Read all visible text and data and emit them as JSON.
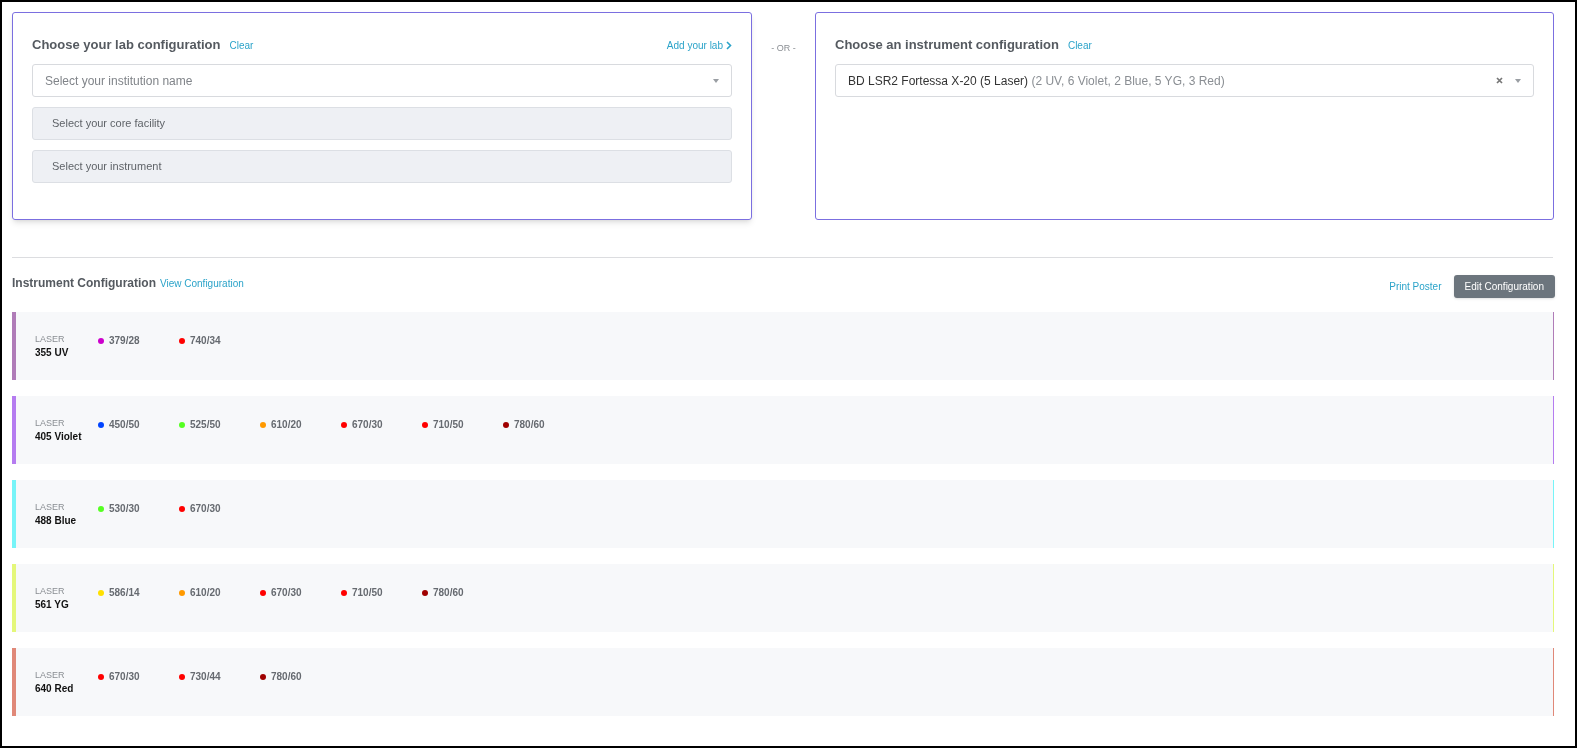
{
  "lab_config": {
    "title": "Choose your lab configuration",
    "clear": "Clear",
    "add_lab": "Add your lab",
    "institution": {
      "placeholder": "Select your institution name"
    },
    "core_facility": {
      "placeholder": "Select your core facility",
      "disabled": true
    },
    "instrument": {
      "placeholder": "Select your instrument",
      "disabled": true
    }
  },
  "separator": "- OR -",
  "instrument_config": {
    "title": "Choose an instrument configuration",
    "clear": "Clear",
    "value": "BD LSR2 Fortessa X-20 (5 Laser)",
    "detail": "(2 UV, 6 Violet, 2 Blue, 5 YG, 3 Red)"
  },
  "configuration": {
    "title": "Instrument Configuration",
    "view_link": "View Configuration",
    "print_link": "Print Poster",
    "edit_button": "Edit Configuration",
    "lasers": [
      {
        "label": "LASER",
        "name": "355 UV",
        "color": "#b07cb8",
        "filters": [
          {
            "name": "379/28",
            "color": "#cc00cc"
          },
          {
            "name": "740/34",
            "color": "#ff0000"
          }
        ]
      },
      {
        "label": "LASER",
        "name": "405 Violet",
        "color": "#b57cf0",
        "filters": [
          {
            "name": "450/50",
            "color": "#0044ff"
          },
          {
            "name": "525/50",
            "color": "#55ff22"
          },
          {
            "name": "610/20",
            "color": "#ff9900"
          },
          {
            "name": "670/30",
            "color": "#ff0000"
          },
          {
            "name": "710/50",
            "color": "#ff0000"
          },
          {
            "name": "780/60",
            "color": "#a00000"
          }
        ]
      },
      {
        "label": "LASER",
        "name": "488 Blue",
        "color": "#77f4f8",
        "filters": [
          {
            "name": "530/30",
            "color": "#55ff22"
          },
          {
            "name": "670/30",
            "color": "#ff0000"
          }
        ]
      },
      {
        "label": "LASER",
        "name": "561 YG",
        "color": "#e4f77a",
        "filters": [
          {
            "name": "586/14",
            "color": "#ffe000"
          },
          {
            "name": "610/20",
            "color": "#ff9900"
          },
          {
            "name": "670/30",
            "color": "#ff0000"
          },
          {
            "name": "710/50",
            "color": "#ff0000"
          },
          {
            "name": "780/60",
            "color": "#a00000"
          }
        ]
      },
      {
        "label": "LASER",
        "name": "640 Red",
        "color": "#e08878",
        "filters": [
          {
            "name": "670/30",
            "color": "#ff0000"
          },
          {
            "name": "730/44",
            "color": "#ff0000"
          },
          {
            "name": "780/60",
            "color": "#a00000"
          }
        ]
      }
    ]
  }
}
